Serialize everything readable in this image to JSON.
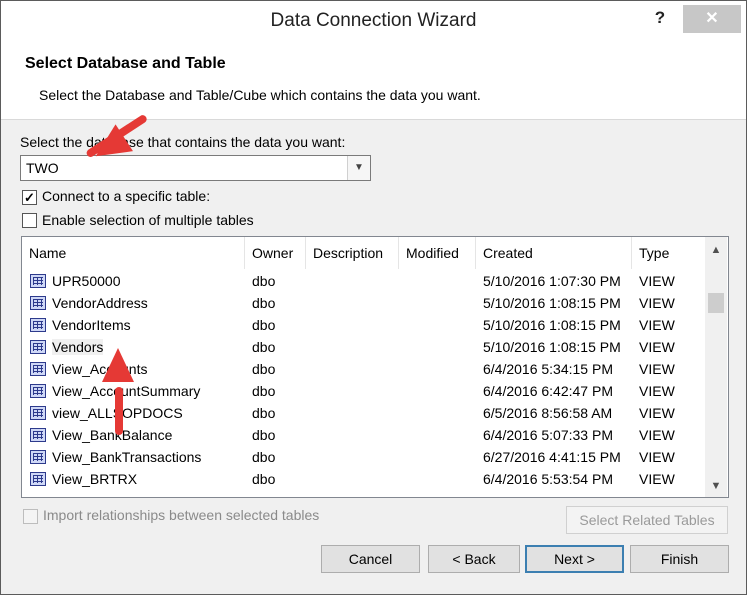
{
  "window": {
    "title": "Data Connection Wizard",
    "help": "?",
    "close": "✕"
  },
  "header": {
    "title": "Select Database and Table",
    "subtitle": "Select the Database and Table/Cube which contains the data you want."
  },
  "database": {
    "label": "Select the database that contains the data you want:",
    "value": "TWO"
  },
  "options": {
    "connect_specific": {
      "label": "Connect to a specific table:",
      "checked": true
    },
    "multiple_tables": {
      "label": "Enable selection of multiple tables",
      "checked": false
    }
  },
  "table": {
    "columns": [
      "Name",
      "Owner",
      "Description",
      "Modified",
      "Created",
      "Type"
    ],
    "rows": [
      {
        "name": "UPR50000",
        "owner": "dbo",
        "description": "",
        "modified": "",
        "created": "5/10/2016 1:07:30 PM",
        "type": "VIEW"
      },
      {
        "name": "VendorAddress",
        "owner": "dbo",
        "description": "",
        "modified": "",
        "created": "5/10/2016 1:08:15 PM",
        "type": "VIEW"
      },
      {
        "name": "VendorItems",
        "owner": "dbo",
        "description": "",
        "modified": "",
        "created": "5/10/2016 1:08:15 PM",
        "type": "VIEW"
      },
      {
        "name": "Vendors",
        "owner": "dbo",
        "description": "",
        "modified": "",
        "created": "5/10/2016 1:08:15 PM",
        "type": "VIEW"
      },
      {
        "name": "View_Accounts",
        "owner": "dbo",
        "description": "",
        "modified": "",
        "created": "6/4/2016 5:34:15 PM",
        "type": "VIEW"
      },
      {
        "name": "View_AccountSummary",
        "owner": "dbo",
        "description": "",
        "modified": "",
        "created": "6/4/2016 6:42:47 PM",
        "type": "VIEW"
      },
      {
        "name": "view_ALLSOPDOCS",
        "owner": "dbo",
        "description": "",
        "modified": "",
        "created": "6/5/2016 8:56:58 AM",
        "type": "VIEW"
      },
      {
        "name": "View_BankBalance",
        "owner": "dbo",
        "description": "",
        "modified": "",
        "created": "6/4/2016 5:07:33 PM",
        "type": "VIEW"
      },
      {
        "name": "View_BankTransactions",
        "owner": "dbo",
        "description": "",
        "modified": "",
        "created": "6/27/2016 4:41:15 PM",
        "type": "VIEW"
      },
      {
        "name": "View_BRTRX",
        "owner": "dbo",
        "description": "",
        "modified": "",
        "created": "6/4/2016 5:53:54 PM",
        "type": "VIEW"
      }
    ],
    "selected_row": "Vendors"
  },
  "import_relationships": "Import relationships between selected tables",
  "buttons": {
    "select_related": "Select Related Tables",
    "cancel": "Cancel",
    "back": "< Back",
    "next": "Next >",
    "finish": "Finish"
  },
  "annotation_color": "#e53935"
}
